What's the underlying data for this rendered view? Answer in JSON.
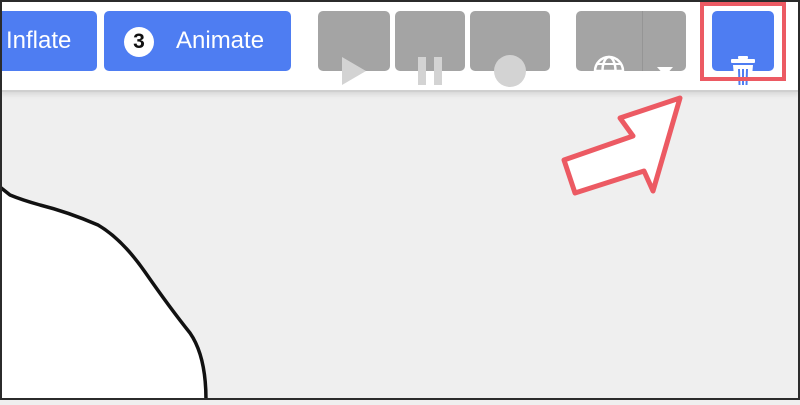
{
  "toolbar": {
    "inflate_label": "Inflate",
    "animate_step": "3",
    "animate_label": "Animate",
    "play_icon": "play-icon",
    "pause_icon": "pause-icon",
    "record_icon": "record-icon",
    "language_icon": "globe-icon",
    "dropdown_icon": "caret-down-icon",
    "delete_icon": "trash-icon"
  },
  "colors": {
    "primary": "#4e7df2",
    "disabled": "#a4a4a4",
    "highlight": "#ec5a63",
    "canvas_bg": "#efefef"
  }
}
